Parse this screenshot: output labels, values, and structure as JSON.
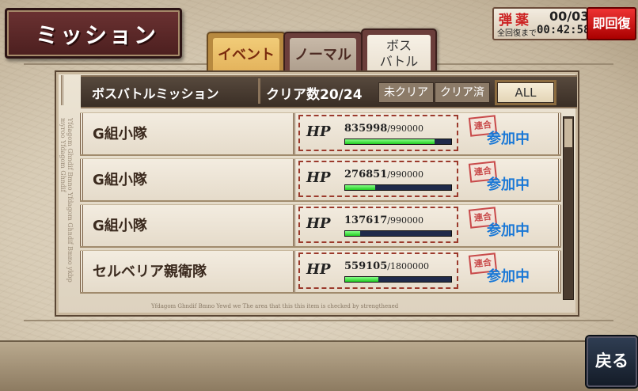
{
  "title": "ミッション",
  "ammo": {
    "label": "弾薬",
    "value": "00/03",
    "recover_label": "全回復まで",
    "recover_time": "00:42:58"
  },
  "instant_recover_label": "即回復",
  "tabs": [
    {
      "label": "イベント"
    },
    {
      "label": "ノーマル"
    },
    {
      "label_line1": "ボス",
      "label_line2": "バトル"
    }
  ],
  "header": {
    "title": "ボスバトルミッション",
    "clear_count": "クリア数20/24",
    "filters": [
      {
        "label": "未クリア"
      },
      {
        "label": "クリア済"
      },
      {
        "label": "ALL"
      }
    ]
  },
  "margin_text": "Yfdagom Ghndif Bmno Yfdagom Ghndif Bmno ykbp myroo Yfdagom Ghndif",
  "footer_text": "Yfdagom Ghndif Bmno Yewd we   The area that this this item is checked by strengthened",
  "missions": [
    {
      "name": "G組小隊",
      "hp_logo": "HP",
      "hp_current": "835998",
      "hp_max": "/990000",
      "hp_ratio": 0.844,
      "stamp": "連合",
      "status": "参加中"
    },
    {
      "name": "G組小隊",
      "hp_logo": "HP",
      "hp_current": "276851",
      "hp_max": "/990000",
      "hp_ratio": 0.28,
      "stamp": "連合",
      "status": "参加中"
    },
    {
      "name": "G組小隊",
      "hp_logo": "HP",
      "hp_current": "137617",
      "hp_max": "/990000",
      "hp_ratio": 0.139,
      "stamp": "連合",
      "status": "参加中"
    },
    {
      "name": "セルベリア親衛隊",
      "hp_logo": "HP",
      "hp_current": "559105",
      "hp_max": "/1800000",
      "hp_ratio": 0.311,
      "stamp": "連合",
      "status": "参加中"
    }
  ],
  "back_label": "戻る"
}
